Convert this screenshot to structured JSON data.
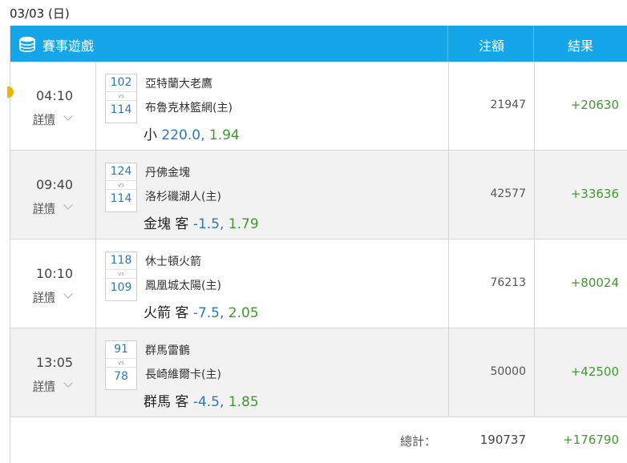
{
  "date_title": "03/03 (日)",
  "header": {
    "game_label": "賽事遊戲",
    "bet_label": "注額",
    "result_label": "結果",
    "icon": "coin-stack-icon",
    "color": "#14a6e8"
  },
  "detail_label": "詳情",
  "vs_label": "vs",
  "rows": [
    {
      "time": "04:10",
      "score_top": "102",
      "score_bottom": "114",
      "team_top": "亞特蘭大老鷹",
      "team_bottom": "布魯克林籃網(主)",
      "pick_name": "小",
      "pick_side": "",
      "pick_line": "220.0,",
      "pick_odds": "1.94",
      "amount": "21947",
      "result": "+20630"
    },
    {
      "time": "09:40",
      "score_top": "124",
      "score_bottom": "114",
      "team_top": "丹佛金塊",
      "team_bottom": "洛杉磯湖人(主)",
      "pick_name": "金塊",
      "pick_side": "客",
      "pick_line": "-1.5,",
      "pick_odds": "1.79",
      "amount": "42577",
      "result": "+33636"
    },
    {
      "time": "10:10",
      "score_top": "118",
      "score_bottom": "109",
      "team_top": "休士頓火箭",
      "team_bottom": "鳳凰城太陽(主)",
      "pick_name": "火箭",
      "pick_side": "客",
      "pick_line": "-7.5,",
      "pick_odds": "2.05",
      "amount": "76213",
      "result": "+80024"
    },
    {
      "time": "13:05",
      "score_top": "91",
      "score_bottom": "78",
      "team_top": "群馬雷鶴",
      "team_bottom": "長崎維爾卡(主)",
      "pick_name": "群馬",
      "pick_side": "客",
      "pick_line": "-4.5,",
      "pick_odds": "1.85",
      "amount": "50000",
      "result": "+42500"
    }
  ],
  "total": {
    "label": "總計：",
    "bet": "190737",
    "result": "+176790"
  }
}
